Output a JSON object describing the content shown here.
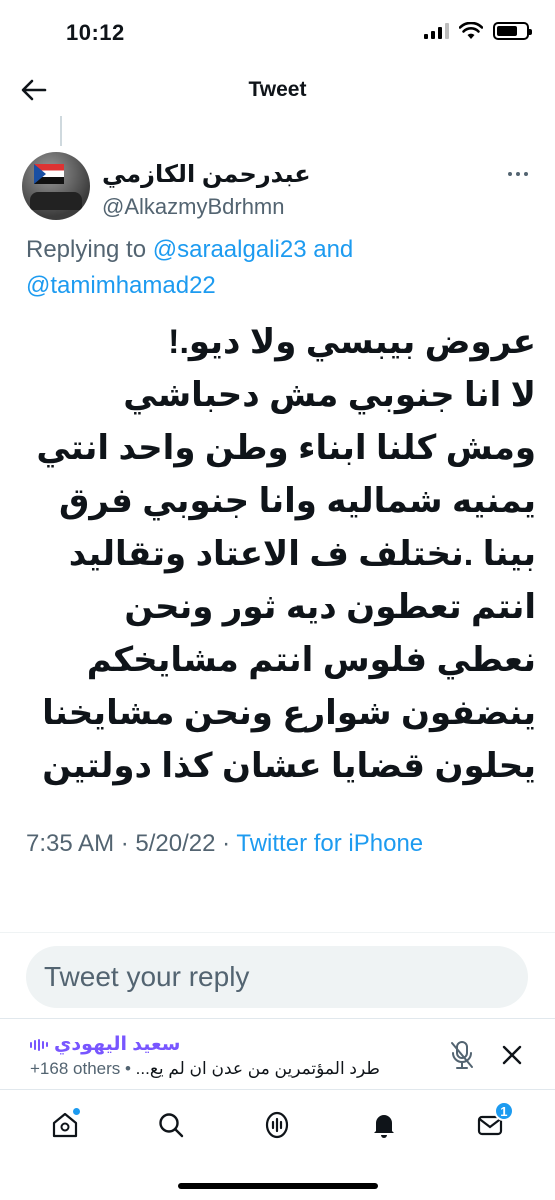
{
  "status_bar": {
    "time": "10:12"
  },
  "header": {
    "title": "Tweet"
  },
  "tweet": {
    "author": {
      "display_name": "عبدرحمن الكازمي",
      "handle": "@AlkazmyBdrhmn"
    },
    "replying_prefix": "Replying to",
    "replying_to": [
      "@saraalgali23",
      "@tamimhamad22"
    ],
    "replying_conjunction": "and",
    "text": "عروض بيبسي ولا ديو.!\nلا انا جنوبي مش دحباشي\nومش كلنا ابناء وطن واحد انتي\nيمنيه شماليه وانا جنوبي فرق\nبينا .نختلف ف الاعتاد وتقاليد\nانتم تعطون ديه ثور ونحن\nنعطي فلوس انتم مشايخكم\nينضفون شوارع ونحن مشايخنا\nيحلون قضايا عشان كذا دولتين",
    "time": "7:35 AM",
    "date": "5/20/22",
    "source": "Twitter for iPhone"
  },
  "reply": {
    "placeholder": "Tweet your reply"
  },
  "space": {
    "host": "سعيد اليهودي",
    "listeners": "+168 others",
    "topic": "طرد المؤتمرين من عدن ان لم يع..."
  },
  "tab_bar": {
    "items": [
      {
        "name": "home-icon",
        "has_dot": true
      },
      {
        "name": "search-icon"
      },
      {
        "name": "spaces-icon"
      },
      {
        "name": "notifications-icon"
      },
      {
        "name": "messages-icon",
        "badge": "1"
      }
    ]
  },
  "colors": {
    "accent": "#1d9bf0",
    "space": "#7856ff",
    "secondary_text": "#536471"
  },
  "icons": [
    "back-arrow-icon",
    "more-icon",
    "mic-muted-icon",
    "close-icon",
    "home-icon",
    "search-icon",
    "spaces-icon",
    "bell-icon",
    "mail-icon"
  ]
}
